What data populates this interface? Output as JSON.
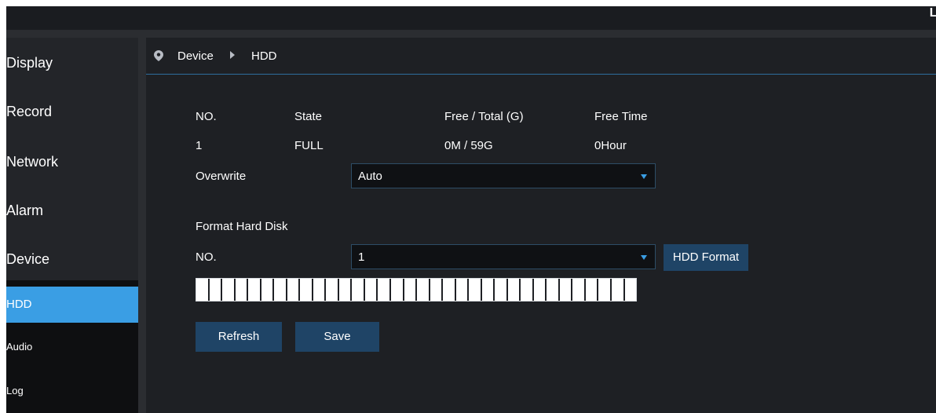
{
  "topbar": {
    "corner_text": "Li"
  },
  "sidebar": {
    "items": [
      {
        "label": "Display"
      },
      {
        "label": "Record"
      },
      {
        "label": "Network"
      },
      {
        "label": "Alarm"
      },
      {
        "label": "Device"
      }
    ],
    "subitems": [
      {
        "label": "HDD",
        "active": true
      },
      {
        "label": "Audio"
      },
      {
        "label": "Log"
      }
    ]
  },
  "breadcrumb": {
    "level1": "Device",
    "level2": "HDD"
  },
  "hdd_table": {
    "headers": [
      "NO.",
      "State",
      "Free / Total (G)",
      "Free Time"
    ],
    "rows": [
      [
        "1",
        "FULL",
        "0M / 59G",
        "0Hour"
      ]
    ]
  },
  "overwrite": {
    "label": "Overwrite",
    "value": "Auto"
  },
  "format": {
    "section_title": "Format Hard Disk",
    "no_label": "NO.",
    "no_value": "1",
    "button_label": "HDD Format",
    "progress_segments": 34,
    "progress_value": 1.0
  },
  "actions": {
    "refresh_label": "Refresh",
    "save_label": "Save"
  },
  "colors": {
    "accent": "#3a9ee4",
    "button": "#1f4466",
    "panel": "#1e2024",
    "sidebar": "#232529"
  }
}
